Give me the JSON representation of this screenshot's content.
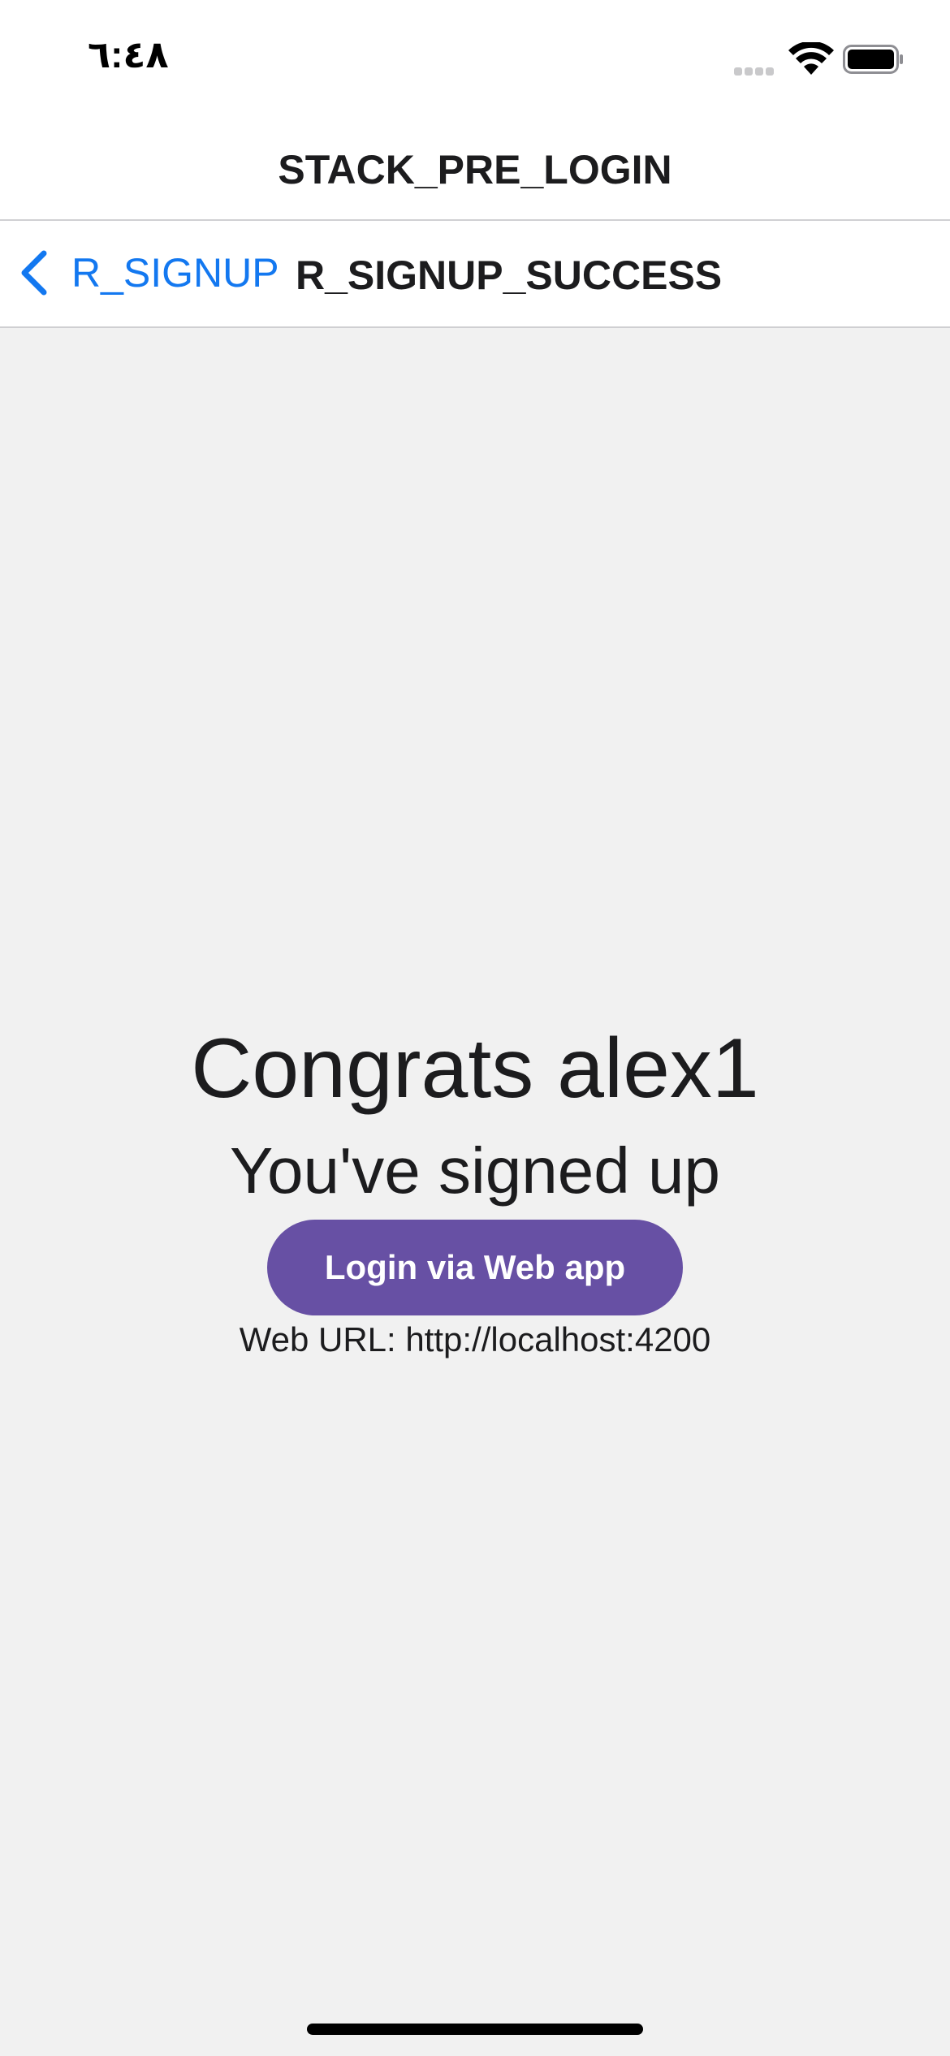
{
  "status_bar": {
    "time": "٦:٤٨"
  },
  "stack_header": {
    "title": "STACK_PRE_LOGIN"
  },
  "nav_bar": {
    "back_label": "R_SIGNUP",
    "title": "R_SIGNUP_SUCCESS"
  },
  "main": {
    "congrats_text": "Congrats alex1",
    "signed_up_text": "You've signed up",
    "login_button_label": "Login via Web app",
    "web_url_text": "Web URL: http://localhost:4200"
  },
  "colors": {
    "accent_blue": "#1378f0",
    "button_purple": "#6750a4",
    "background": "#f1f1f1"
  }
}
